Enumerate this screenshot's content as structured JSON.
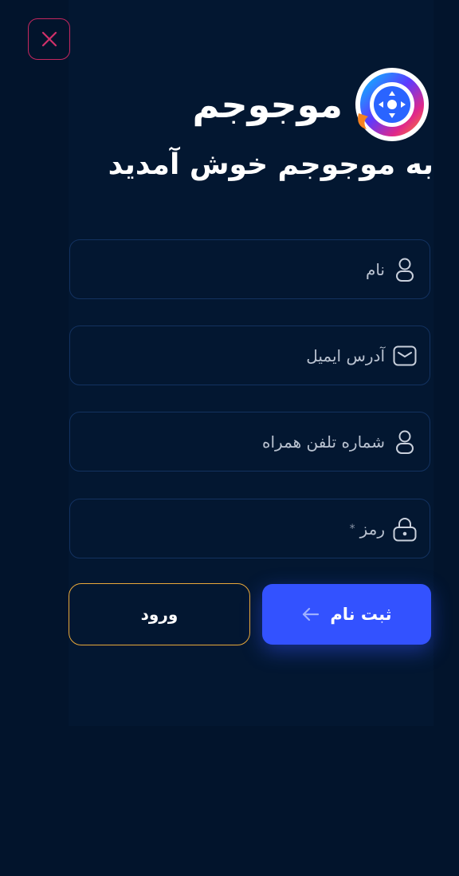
{
  "brand": {
    "name": "موجوجم"
  },
  "welcome_text": "به موجوجم خوش آمدید",
  "form": {
    "fields": [
      {
        "label": "نام",
        "icon": "user-icon"
      },
      {
        "label": "آدرس ایمیل",
        "icon": "mail-icon"
      },
      {
        "label": "شماره تلفن همراه",
        "icon": "user-icon"
      },
      {
        "label": "رمز",
        "icon": "lock-icon",
        "required_mark": "*"
      }
    ]
  },
  "actions": {
    "register_label": "ثبت نام",
    "login_label": "ورود"
  },
  "colors": {
    "background": "#02142c",
    "panel": "#031731",
    "primary": "#3352ff",
    "login_border": "#e8a83a",
    "close_border": "#c4275f",
    "logo_accent": "#f58220"
  }
}
